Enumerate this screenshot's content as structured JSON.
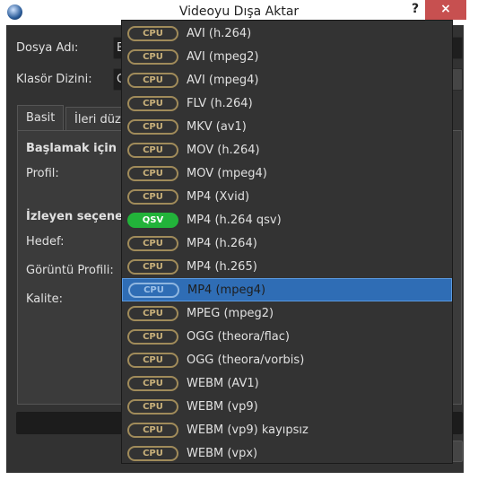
{
  "window": {
    "title": "Videoyu Dışa Aktar",
    "help": "?",
    "close": "×"
  },
  "form": {
    "file_name_label": "Dosya Adı:",
    "file_name_value": "E",
    "folder_label": "Klasör Dizini:",
    "folder_value": "C"
  },
  "tabs": [
    {
      "label": "Basit"
    },
    {
      "label": "İleri düz"
    }
  ],
  "panel": {
    "heading1": "Başlamak için b",
    "profile_label": "Profil:",
    "heading2": "İzleyen seçene",
    "target_label": "Hedef:",
    "video_profile_label": "Görüntü Profili:",
    "quality_label": "Kalite:"
  },
  "dropdown": {
    "selected_index": 11,
    "items": [
      {
        "badge": "CPU",
        "label": "AVI (h.264)"
      },
      {
        "badge": "CPU",
        "label": "AVI (mpeg2)"
      },
      {
        "badge": "CPU",
        "label": "AVI (mpeg4)"
      },
      {
        "badge": "CPU",
        "label": "FLV (h.264)"
      },
      {
        "badge": "CPU",
        "label": "MKV (av1)"
      },
      {
        "badge": "CPU",
        "label": "MOV (h.264)"
      },
      {
        "badge": "CPU",
        "label": "MOV (mpeg4)"
      },
      {
        "badge": "CPU",
        "label": "MP4 (Xvid)"
      },
      {
        "badge": "QSV",
        "label": "MP4 (h.264 qsv)"
      },
      {
        "badge": "CPU",
        "label": "MP4 (h.264)"
      },
      {
        "badge": "CPU",
        "label": "MP4 (h.265)"
      },
      {
        "badge": "CPU",
        "label": "MP4 (mpeg4)"
      },
      {
        "badge": "CPU",
        "label": "MPEG (mpeg2)"
      },
      {
        "badge": "CPU",
        "label": "OGG (theora/flac)"
      },
      {
        "badge": "CPU",
        "label": "OGG (theora/vorbis)"
      },
      {
        "badge": "CPU",
        "label": "WEBM (AV1)"
      },
      {
        "badge": "CPU",
        "label": "WEBM (vp9)"
      },
      {
        "badge": "CPU",
        "label": "WEBM (vp9) kayıpsız"
      },
      {
        "badge": "CPU",
        "label": "WEBM (vpx)"
      }
    ]
  },
  "colors": {
    "cpu_badge": "#a08b5a",
    "qsv_badge": "#22b33a",
    "selection": "#2f6db5",
    "close": "#c75050"
  }
}
